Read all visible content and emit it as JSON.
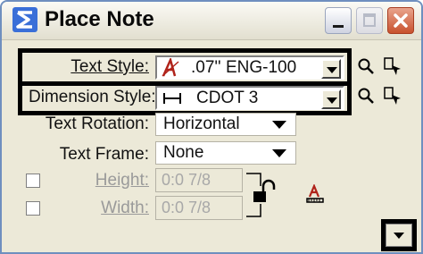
{
  "window": {
    "title": "Place Note"
  },
  "titlebar": {
    "minimize": "_",
    "maximize": "□",
    "close": "X"
  },
  "form": {
    "text_style": {
      "label": "Text Style:",
      "value": ".07'' ENG-100"
    },
    "dimension_style": {
      "label": "Dimension Style:",
      "value": "CDOT 3"
    },
    "text_rotation": {
      "label": "Text Rotation:",
      "value": "Horizontal"
    },
    "text_frame": {
      "label": "Text Frame:",
      "value": "None"
    },
    "height": {
      "label": "Height:",
      "value": "0:0 7/8"
    },
    "width": {
      "label": "Width:",
      "value": "0:0 7/8"
    }
  },
  "icons": {
    "app": "microstation-icon",
    "text_style_glyph": "text-style-icon",
    "dimension_glyph": "dimension-icon",
    "magnifier": "magnifier-icon",
    "pick": "pick-element-icon",
    "lock": "lock-icon",
    "text_attr": "text-attributes-icon",
    "expand": "expand-down-icon"
  },
  "colors": {
    "highlight": "#000000",
    "dialog_bg": "#ece9d8",
    "title_close": "#c8512e",
    "text_style_glyph": "#b0231a"
  }
}
